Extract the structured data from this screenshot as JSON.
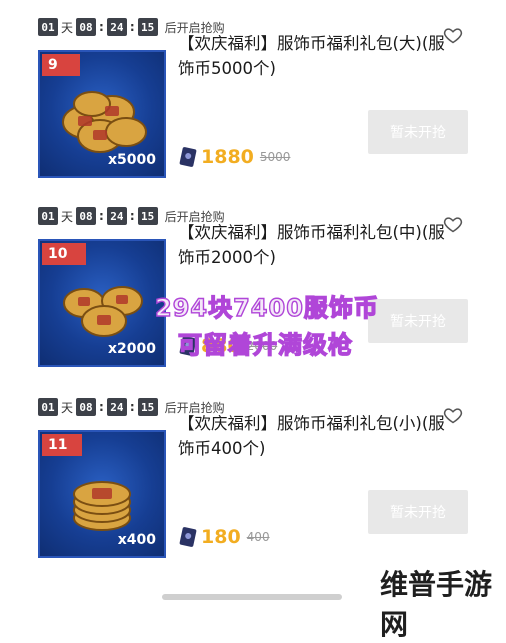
{
  "timer": {
    "days": "01",
    "days_label": "天",
    "hours": "08",
    "minutes": "24",
    "seconds": "15",
    "status": "后开启抢购"
  },
  "buy_button_label": "暂未开抢",
  "items": [
    {
      "rank": "9",
      "title": "【欢庆福利】服饰币福利礼包(大)(服饰币5000个)",
      "quantity": "x5000",
      "price": "1880",
      "original_price": "5000"
    },
    {
      "rank": "10",
      "title": "【欢庆福利】服饰币福利礼包(中)(服饰币2000个)",
      "quantity": "x2000",
      "price": "880",
      "original_price": "2000"
    },
    {
      "rank": "11",
      "title": "【欢庆福利】服饰币福利礼包(小)(服饰币400个)",
      "quantity": "x400",
      "price": "180",
      "original_price": "400"
    }
  ],
  "overlay": {
    "line1": "294块7400服饰币",
    "line2": "可留着升满级枪"
  },
  "watermark": "维普手游网",
  "icons": {
    "heart": "heart-outline-icon",
    "ticket": "ticket-currency-icon",
    "coins": "coin-stack-icon"
  },
  "colors": {
    "price": "#f2ad21",
    "rank_badge": "#d8443f",
    "overlay_stroke": "#b046d8",
    "thumb_bg": "#163e93"
  }
}
